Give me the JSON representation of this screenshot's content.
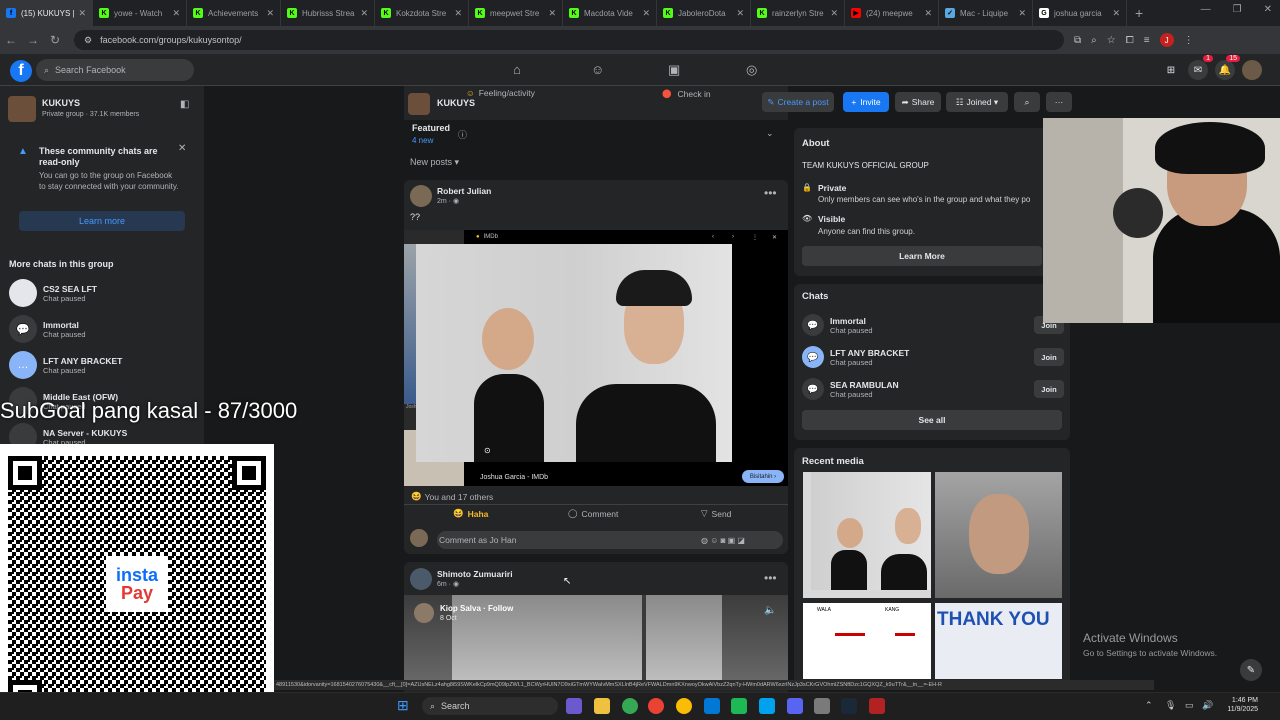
{
  "browser": {
    "tabs": [
      {
        "label": "(15) KUKUYS |",
        "fav": "f",
        "color": "#1877f2",
        "active": true
      },
      {
        "label": "yowe - Watch",
        "fav": "K",
        "color": "#53fc18"
      },
      {
        "label": "Achievements",
        "fav": "K",
        "color": "#53fc18"
      },
      {
        "label": "Hubrisss Strea",
        "fav": "K",
        "color": "#53fc18"
      },
      {
        "label": "Kokzdota Stre",
        "fav": "K",
        "color": "#53fc18"
      },
      {
        "label": "meepwet Stre",
        "fav": "K",
        "color": "#53fc18"
      },
      {
        "label": "Macdota Vide",
        "fav": "K",
        "color": "#53fc18"
      },
      {
        "label": "JaboleroDota",
        "fav": "K",
        "color": "#53fc18"
      },
      {
        "label": "rainzerlyn Stre",
        "fav": "K",
        "color": "#53fc18"
      },
      {
        "label": "(24) meepwe",
        "fav": "▶",
        "color": "#ff0000"
      },
      {
        "label": "Mac - Liquipe",
        "fav": "✓",
        "color": "#5aa7e0"
      },
      {
        "label": "joshua garcia",
        "fav": "G",
        "color": "#ffffff"
      }
    ],
    "url": "facebook.com/groups/kukuysontop/"
  },
  "fb": {
    "search_placeholder": "Search Facebook",
    "notif_count": "15",
    "messenger_count": "1"
  },
  "group": {
    "name": "KUKUYS",
    "privacy": "Private group · 37.1K members",
    "notice_title": "These community chats are read-only",
    "notice_body": "You can go to the group on Facebook to stay connected with your community.",
    "learn_more": "Learn more",
    "more_chats_title": "More chats in this group",
    "chats": [
      {
        "name": "CS2 SEA LFT",
        "status": "Chat paused",
        "av": ""
      },
      {
        "name": "Immortal",
        "status": "Chat paused",
        "av": "💬"
      },
      {
        "name": "LFT ANY BRACKET",
        "status": "Chat paused",
        "av": "…"
      },
      {
        "name": "Middle East (OFW)",
        "status": "Chat paused",
        "av": ""
      },
      {
        "name": "NA Server - KUKUYS",
        "status": "Chat paused",
        "av": ""
      }
    ]
  },
  "feed": {
    "header_name": "KUKUYS",
    "feeling": "Feeling/activity",
    "checkin": "Check in",
    "featured": "Featured",
    "featured_new": "4 new",
    "new_posts": "New posts",
    "post1": {
      "author": "Robert Julian",
      "time": "2m",
      "text": "??",
      "embed_source": "IMDb",
      "embed_caption": "Joshua Garcia - IMDb",
      "embed_btn": "Bisitahin",
      "thumb_caption": "Joshua Garcia - Josh...",
      "reactions": "You and 17 others",
      "haha": "Haha",
      "comment": "Comment",
      "send": "Send",
      "comment_placeholder": "Comment as Jo Han"
    },
    "post2": {
      "author": "Shimoto Zumuariri",
      "time": "6m",
      "shared_author": "Kiop Salva · Follow",
      "shared_time": "8 Oct"
    }
  },
  "actions": {
    "create_post": "Create a post",
    "invite": "Invite",
    "share": "Share",
    "joined": "Joined"
  },
  "about": {
    "title": "About",
    "desc": "TEAM KUKUYS OFFICIAL GROUP",
    "private_title": "Private",
    "private_desc": "Only members can see who's in the group and what they po",
    "visible_title": "Visible",
    "visible_desc": "Anyone can find this group.",
    "learn_more": "Learn More"
  },
  "chats_section": {
    "title": "Chats",
    "items": [
      {
        "name": "Immortal",
        "status": "Chat paused",
        "join": "Join"
      },
      {
        "name": "LFT ANY BRACKET",
        "status": "Chat paused",
        "join": "Join"
      },
      {
        "name": "SEA RAMBULAN",
        "status": "Chat paused",
        "join": "Join"
      }
    ],
    "see_all": "See all"
  },
  "media": {
    "title": "Recent media",
    "thank_you": "THANK YOU",
    "wala": "WALA",
    "kang": "KANG"
  },
  "overlay": {
    "subgoal": "SubGoal pang kasal - 87/3000",
    "insta": "insta",
    "pay": "Pay"
  },
  "windows": {
    "activate_title": "Activate Windows",
    "activate_body": "Go to Settings to activate Windows.",
    "search": "Search",
    "time": "1:46 PM",
    "date": "11/9/2025"
  },
  "status_url": "48911530&idorvanity=1681540276075430&__cft__[0]=AZUsNELz4ahg8i59SWKelkCp9mQ09lpZWL1_BCWyrHUlN7O9xiGTmWYWaIvMmSXLlnB4jReVFWALDmn9KXnwoyOkwAiVbzZ2qnTy-HWm0dARW6xzrlNzJp3sCKrGVOhmlZSNftDzc1GQXQZ_k9uTTr&__tn__=-EH-R"
}
